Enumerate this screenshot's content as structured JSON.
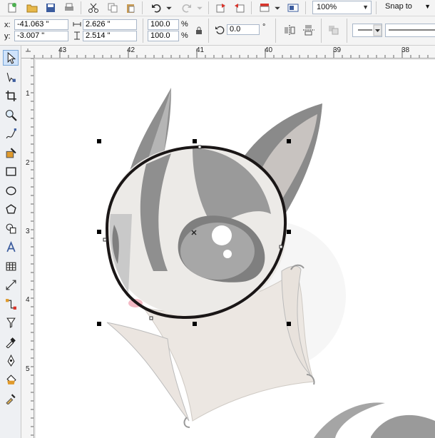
{
  "toolbar": {
    "zoom_value": "100%",
    "snap_label": "Snap to"
  },
  "property_bar": {
    "x_label": "x:",
    "x_value": "-41.063 \"",
    "y_label": "y:",
    "y_value": "-3.007 \"",
    "width_value": "2.626 \"",
    "height_value": "2.514 \"",
    "scale_x": "100.0",
    "scale_y": "100.0",
    "percent_symbol": "%",
    "rotation_value": "0.0",
    "degree_symbol": "°"
  },
  "rulers": {
    "top_ticks": [
      "43",
      "42",
      "41",
      "40",
      "39",
      "38"
    ],
    "left_ticks": [
      "1",
      "2",
      "3",
      "4",
      "5"
    ]
  },
  "colors": {
    "accent": "#7aa7d8",
    "selection_handle": "#000000",
    "ellipse_outline": "#1a1616"
  }
}
